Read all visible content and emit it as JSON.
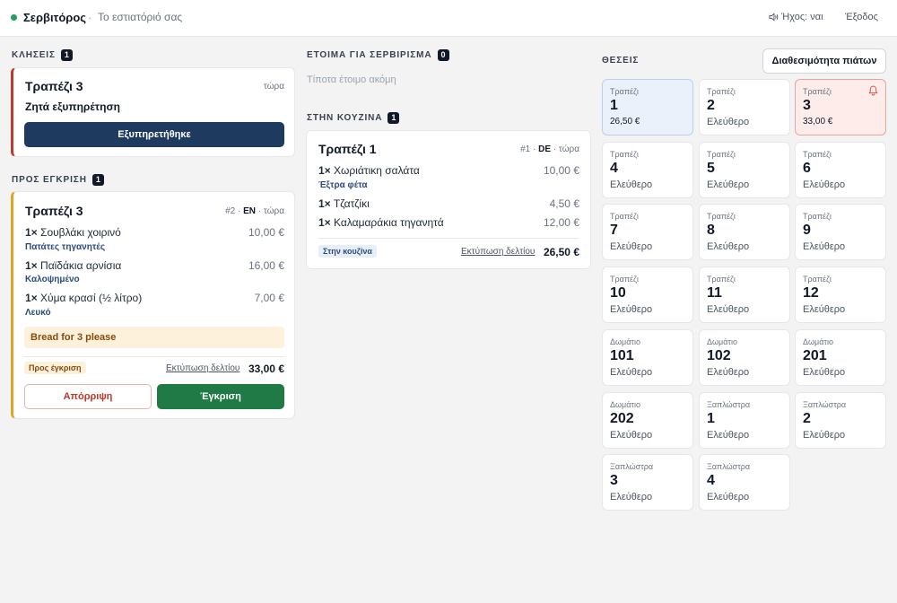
{
  "header": {
    "brand": "Σερβιτόρος",
    "separator": "·",
    "subtitle": "Το εστιατόριό σας",
    "sound_label": "Ήχος: ναι",
    "logout_label": "Έξοδος"
  },
  "calls": {
    "heading": "ΚΛΗΣΕΙΣ",
    "count": "1",
    "card": {
      "title": "Τραπέζι 3",
      "time": "τώρα",
      "message": "Ζητά εξυπηρέτηση",
      "button": "Εξυπηρετήθηκε"
    }
  },
  "approval": {
    "heading": "ΠΡΟΣ ΕΓΚΡΙΣΗ",
    "count": "1",
    "card": {
      "title": "Τραπέζι 3",
      "order_no": "#2",
      "lang": "EN",
      "time": "τώρα",
      "items": [
        {
          "qty": "1×",
          "name": "Σουβλάκι χοιρινό",
          "price": "10,00 €",
          "mod": "Πατάτες τηγανητές"
        },
        {
          "qty": "1×",
          "name": "Παϊδάκια αρνίσια",
          "price": "16,00 €",
          "mod": "Καλοψημένο"
        },
        {
          "qty": "1×",
          "name": "Χύμα κρασί (½ λίτρο)",
          "price": "7,00 €",
          "mod": "Λευκό"
        }
      ],
      "note": "Bread for 3 please",
      "status": "Προς έγκριση",
      "print_label": "Εκτύπωση δελτίου",
      "total": "33,00 €",
      "reject_label": "Απόρριψη",
      "approve_label": "Έγκριση"
    }
  },
  "ready": {
    "heading": "ΕΤΟΙΜΑ ΓΙΑ ΣΕΡΒΙΡΙΣΜΑ",
    "count": "0",
    "empty_text": "Τίποτα έτοιμο ακόμη"
  },
  "kitchen": {
    "heading": "ΣΤΗΝ ΚΟΥΖΙΝΑ",
    "count": "1",
    "card": {
      "title": "Τραπέζι 1",
      "order_no": "#1",
      "lang": "DE",
      "time": "τώρα",
      "items": [
        {
          "qty": "1×",
          "name": "Χωριάτικη σαλάτα",
          "price": "10,00 €",
          "mod": "Έξτρα φέτα"
        },
        {
          "qty": "1×",
          "name": "Τζατζίκι",
          "price": "4,50 €",
          "mod": ""
        },
        {
          "qty": "1×",
          "name": "Καλαμαράκια τηγανητά",
          "price": "12,00 €",
          "mod": ""
        }
      ],
      "status": "Στην κουζίνα",
      "print_label": "Εκτύπωση δελτίου",
      "total": "26,50 €"
    }
  },
  "seats": {
    "heading": "ΘΕΣΕΙΣ",
    "availability_button": "Διαθεσιμότητα πιάτων",
    "tiles": [
      {
        "kind": "Τραπέζι",
        "num": "1",
        "status": "26,50 €",
        "state": "occupied"
      },
      {
        "kind": "Τραπέζι",
        "num": "2",
        "status": "Ελεύθερο",
        "state": "free"
      },
      {
        "kind": "Τραπέζι",
        "num": "3",
        "status": "33,00 €",
        "state": "alert"
      },
      {
        "kind": "Τραπέζι",
        "num": "4",
        "status": "Ελεύθερο",
        "state": "free"
      },
      {
        "kind": "Τραπέζι",
        "num": "5",
        "status": "Ελεύθερο",
        "state": "free"
      },
      {
        "kind": "Τραπέζι",
        "num": "6",
        "status": "Ελεύθερο",
        "state": "free"
      },
      {
        "kind": "Τραπέζι",
        "num": "7",
        "status": "Ελεύθερο",
        "state": "free"
      },
      {
        "kind": "Τραπέζι",
        "num": "8",
        "status": "Ελεύθερο",
        "state": "free"
      },
      {
        "kind": "Τραπέζι",
        "num": "9",
        "status": "Ελεύθερο",
        "state": "free"
      },
      {
        "kind": "Τραπέζι",
        "num": "10",
        "status": "Ελεύθερο",
        "state": "free"
      },
      {
        "kind": "Τραπέζι",
        "num": "11",
        "status": "Ελεύθερο",
        "state": "free"
      },
      {
        "kind": "Τραπέζι",
        "num": "12",
        "status": "Ελεύθερο",
        "state": "free"
      },
      {
        "kind": "Δωμάτιο",
        "num": "101",
        "status": "Ελεύθερο",
        "state": "free"
      },
      {
        "kind": "Δωμάτιο",
        "num": "102",
        "status": "Ελεύθερο",
        "state": "free"
      },
      {
        "kind": "Δωμάτιο",
        "num": "201",
        "status": "Ελεύθερο",
        "state": "free"
      },
      {
        "kind": "Δωμάτιο",
        "num": "202",
        "status": "Ελεύθερο",
        "state": "free"
      },
      {
        "kind": "Ξαπλώστρα",
        "num": "1",
        "status": "Ελεύθερο",
        "state": "free"
      },
      {
        "kind": "Ξαπλώστρα",
        "num": "2",
        "status": "Ελεύθερο",
        "state": "free"
      },
      {
        "kind": "Ξαπλώστρα",
        "num": "3",
        "status": "Ελεύθερο",
        "state": "free"
      },
      {
        "kind": "Ξαπλώστρα",
        "num": "4",
        "status": "Ελεύθερο",
        "state": "free"
      }
    ]
  },
  "icons": {
    "status_dot": "status-dot-icon",
    "sound": "speaker-icon",
    "bell": "bell-icon"
  },
  "colors": {
    "online": "#22a05a",
    "navy": "#1e3a5f",
    "approve": "#1f7a45",
    "reject": "#c0392b",
    "call_accent": "#c0392b",
    "approval_accent": "#e2a325",
    "modifier": "#2b4c7e"
  }
}
